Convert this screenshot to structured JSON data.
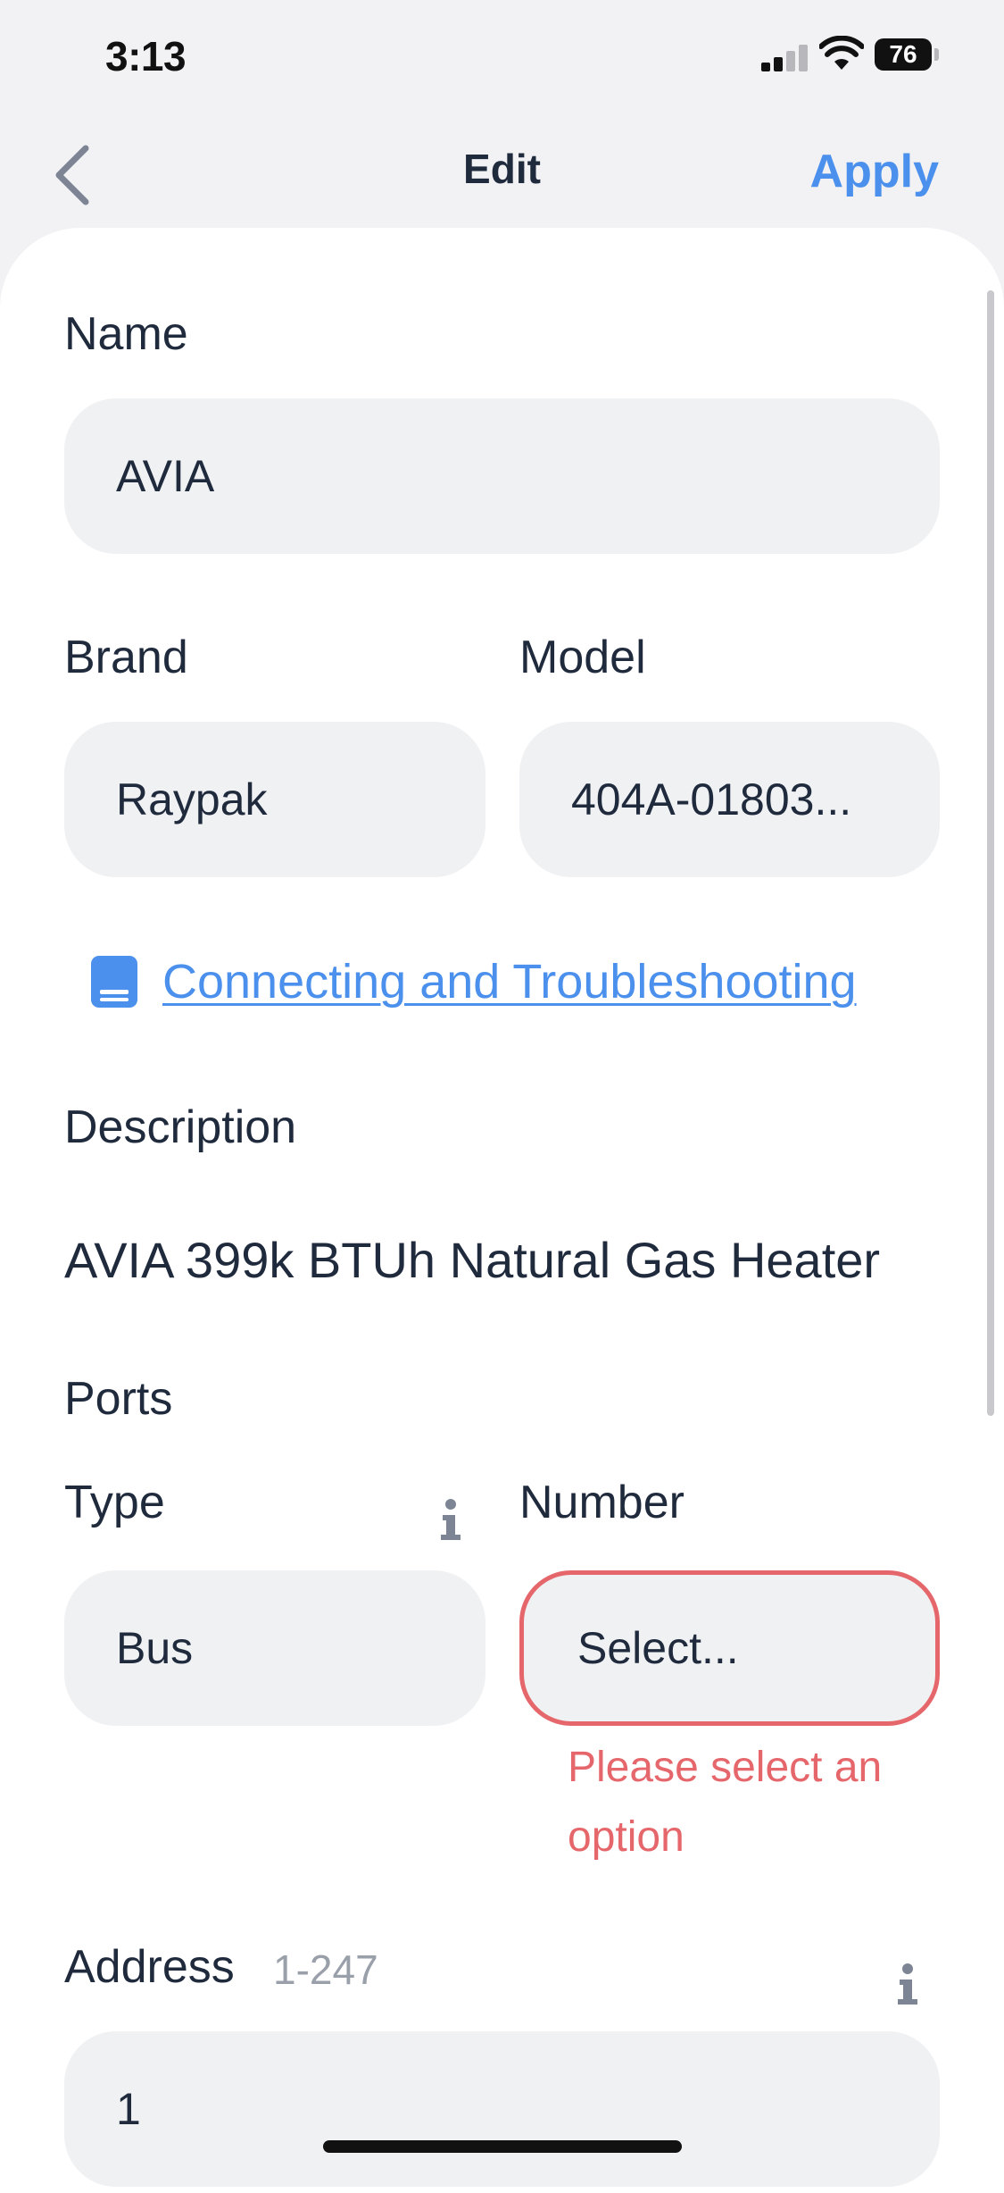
{
  "status_bar": {
    "time": "3:13",
    "battery": "76"
  },
  "nav": {
    "title": "Edit",
    "apply_label": "Apply"
  },
  "form": {
    "name_label": "Name",
    "name_value": "AVIA",
    "brand_label": "Brand",
    "brand_value": "Raypak",
    "model_label": "Model",
    "model_value": "404A-01803...",
    "doc_link": "Connecting and Troubleshooting",
    "description_label": "Description",
    "description_value": "AVIA 399k BTUh Natural Gas Heater",
    "ports_label": "Ports",
    "type_label": "Type",
    "type_value": "Bus",
    "number_label": "Number",
    "number_placeholder": "Select...",
    "number_error": "Please select an option",
    "address_label": "Address",
    "address_hint": "1-247",
    "address_value": "1"
  },
  "colors": {
    "accent": "#4a90ec",
    "error": "#e5676b",
    "field_bg": "#f0f1f3",
    "text": "#1f2a3d"
  },
  "icons": [
    "back-chevron-icon",
    "book-icon",
    "info-icon"
  ]
}
